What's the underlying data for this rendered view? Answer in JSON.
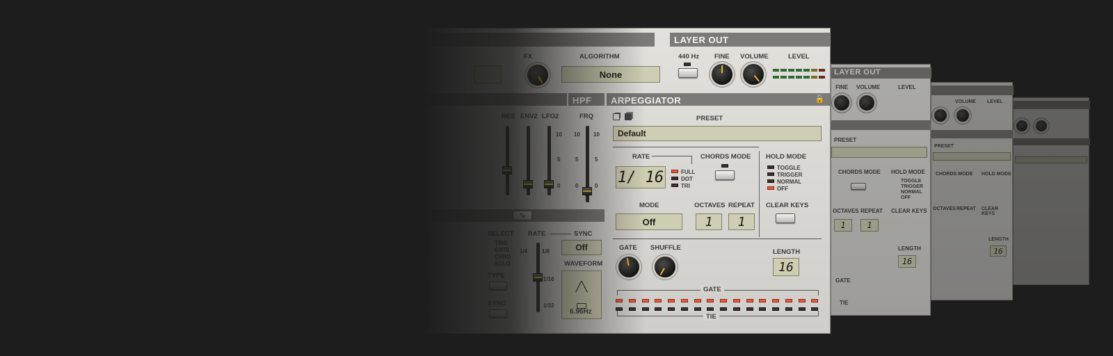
{
  "layer_out": {
    "title": "LAYER OUT",
    "tune_label": "440 Hz",
    "fine_label": "FINE",
    "volume_label": "VOLUME",
    "level_label": "LEVEL"
  },
  "algo": {
    "fx_label": "FX",
    "algorithm_label": "ALGORITHM",
    "algorithm_value": "None"
  },
  "hpf": {
    "title": "HPF",
    "frq_label": "FRQ",
    "scale": [
      "10",
      "5",
      "0"
    ]
  },
  "filter": {
    "res_label": "RES",
    "env2_label": "ENV2",
    "lfo2_label": "LFO2",
    "scale": [
      "10",
      "5",
      "0"
    ]
  },
  "lfo": {
    "select_label": "SELECT",
    "rate_label": "RATE",
    "sync_label": "SYNC",
    "sync_value": "Off",
    "waveform_label": "WAVEFORM",
    "waveform_value": "6.96Hz",
    "rate_scale": [
      "1/4",
      "1/8",
      "1/16",
      "1/32"
    ],
    "select_options": [
      "TRIG",
      "GATE",
      "CHRD",
      "SOLO"
    ],
    "type_label": "TYPE",
    "sync_btn_label": "SYNC"
  },
  "arp": {
    "title": "ARPEGGIATOR",
    "preset_label": "PRESET",
    "preset_value": "Default",
    "rate_label": "RATE",
    "rate_value": "1/ 16",
    "rate_options": [
      {
        "label": "FULL",
        "on": true
      },
      {
        "label": "DOT",
        "on": false
      },
      {
        "label": "TRI",
        "on": false
      }
    ],
    "chords_label": "CHORDS MODE",
    "hold_label": "HOLD MODE",
    "hold_options": [
      {
        "label": "TOGGLE",
        "on": false
      },
      {
        "label": "TRIGGER",
        "on": false
      },
      {
        "label": "NORMAL",
        "on": false
      },
      {
        "label": "OFF",
        "on": true
      }
    ],
    "clear_label": "CLEAR KEYS",
    "mode_label": "MODE",
    "mode_value": "Off",
    "octaves_label": "OCTAVES",
    "octaves_value": "1",
    "repeat_label": "REPEAT",
    "repeat_value": "1",
    "gate_knob_label": "GATE",
    "shuffle_label": "SHUFFLE",
    "length_label": "LENGTH",
    "length_value": "16",
    "gate_row_label": "GATE",
    "tie_row_label": "TIE",
    "steps": 16
  },
  "ghost": {
    "layer_title": "LAYER OUT",
    "fine": "FINE",
    "volume": "VOLUME",
    "level": "LEVEL",
    "preset": "PRESET",
    "chords": "CHORDS MODE",
    "hold": "HOLD MODE",
    "toggle": "TOGGLE",
    "trigger": "TRIGGER",
    "normal": "NORMAL",
    "off": "OFF",
    "octaves": "OCTAVES",
    "repeat": "REPEAT",
    "clear": "CLEAR KEYS",
    "length": "LENGTH",
    "len_val": "16",
    "gate": "GATE",
    "tie": "TIE",
    "one": "1"
  }
}
